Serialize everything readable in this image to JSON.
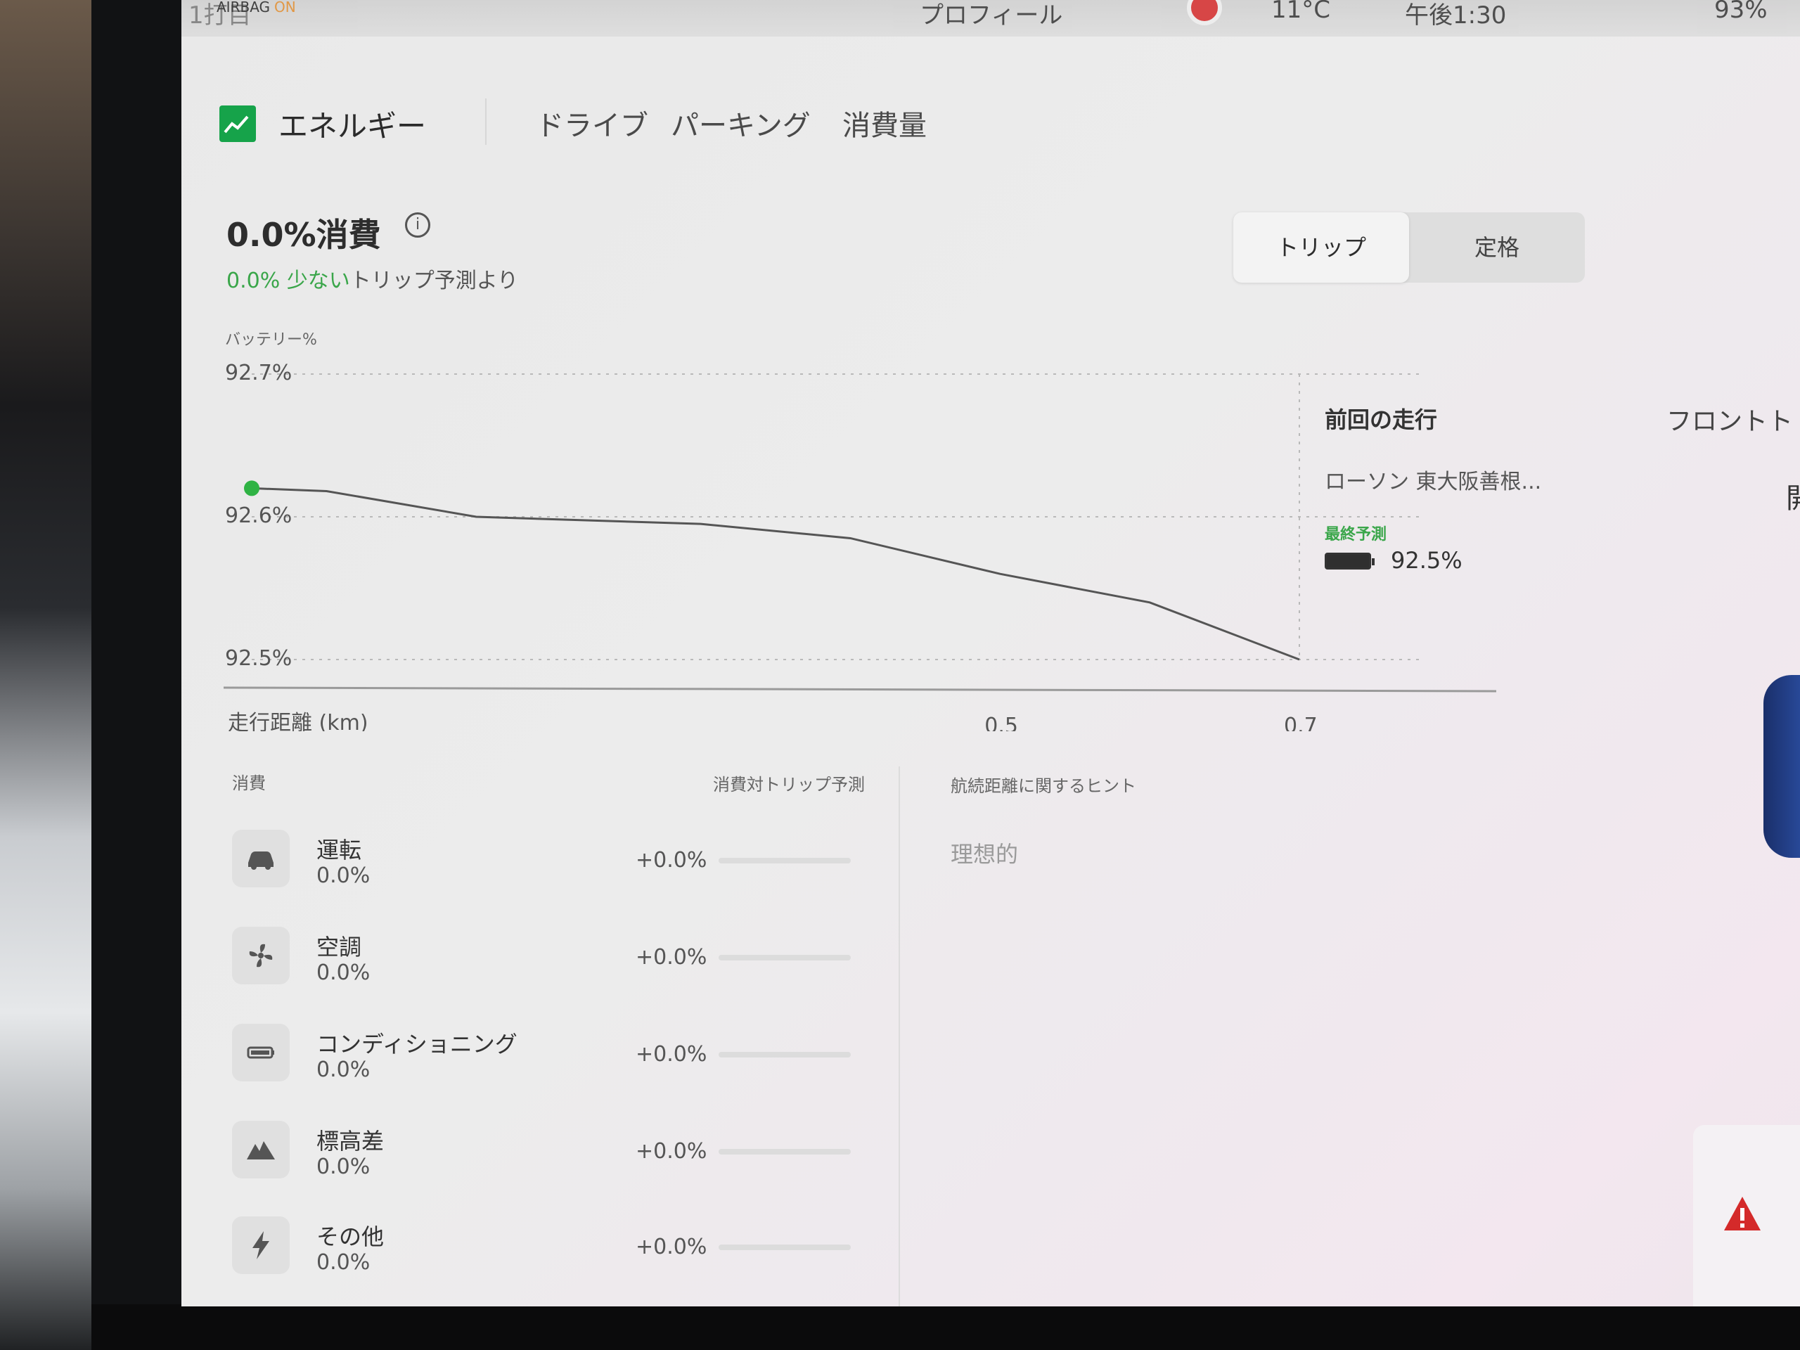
{
  "status_bar": {
    "left_text": "1打目",
    "airbag_label": "AIRBAG",
    "airbag_state": "ON",
    "profile": "プロフィール",
    "temperature": "11°C",
    "time": "午後1:30",
    "battery": "93%"
  },
  "header": {
    "title": "エネルギー",
    "icon": "line-chart-icon",
    "tabs": [
      "ドライブ",
      "パーキング",
      "消費量"
    ]
  },
  "summary": {
    "consumption": "0.0%消費",
    "diff_green": "0.0% 少ない",
    "diff_suffix": "トリップ予測より"
  },
  "segmented": {
    "options": [
      "トリップ",
      "定格"
    ],
    "selected": "トリップ"
  },
  "chart_data": {
    "type": "line",
    "ylabel": "バッテリー%",
    "xlabel": "走行距離 (km)",
    "y_ticks": [
      "92.7%",
      "92.6%",
      "92.5%"
    ],
    "x_ticks": [
      "0.5",
      "0.7"
    ],
    "ylim": [
      92.5,
      92.7
    ],
    "xlim": [
      0,
      0.7
    ],
    "series": [
      {
        "x": [
          0.0,
          0.05,
          0.15,
          0.3,
          0.4,
          0.5,
          0.6,
          0.7
        ],
        "y": [
          92.62,
          92.618,
          92.6,
          92.595,
          92.585,
          92.56,
          92.54,
          92.5
        ]
      }
    ]
  },
  "last_trip": {
    "title": "前回の走行",
    "destination": "ローソン 東大阪善根...",
    "final_label": "最終予測",
    "final_value": "92.5%"
  },
  "consumption_list": {
    "header": "消費",
    "vs_header": "消費対トリップ予測",
    "items": [
      {
        "name": "運転",
        "value": "0.0%",
        "delta": "+0.0%",
        "icon": "car-icon"
      },
      {
        "name": "空調",
        "value": "0.0%",
        "delta": "+0.0%",
        "icon": "fan-icon"
      },
      {
        "name": "コンディショニング",
        "value": "0.0%",
        "delta": "+0.0%",
        "icon": "battery-icon"
      },
      {
        "name": "標高差",
        "value": "0.0%",
        "delta": "+0.0%",
        "icon": "mountain-icon"
      },
      {
        "name": "その他",
        "value": "0.0%",
        "delta": "+0.0%",
        "icon": "bolt-icon"
      }
    ]
  },
  "tips": {
    "header": "航続距離に関するヒント",
    "value": "理想的"
  },
  "right_edge": {
    "partial_title": "フロントト",
    "partial_char": "開"
  },
  "colors": {
    "accent_green": "#3aa64a",
    "icon_green": "#16a34a"
  }
}
